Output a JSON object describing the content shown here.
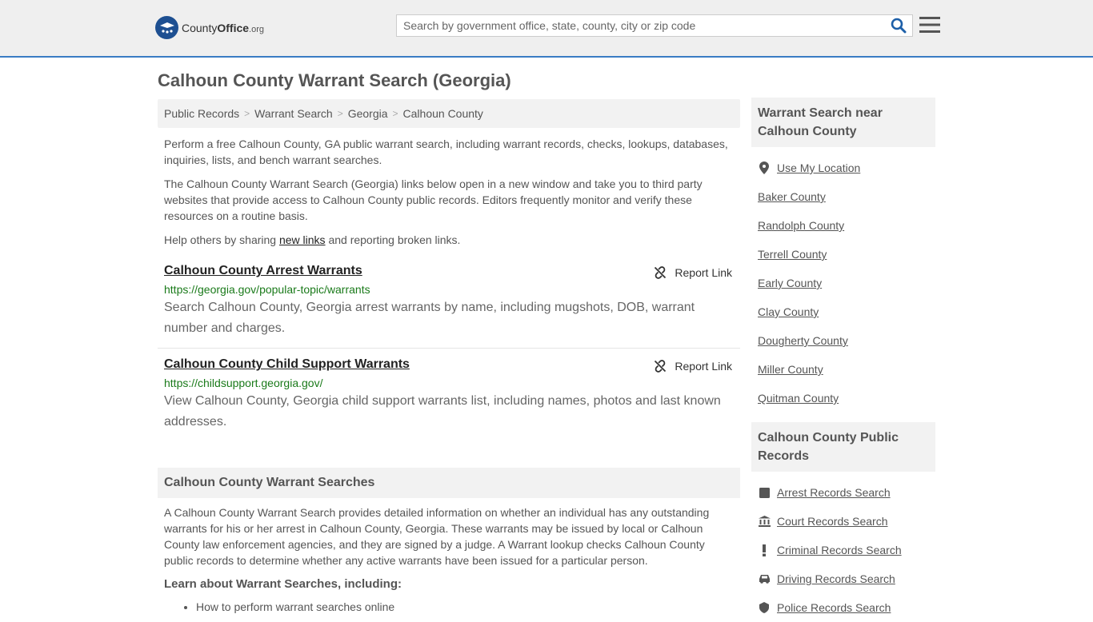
{
  "header": {
    "logo_main": "County",
    "logo_bold": "Office",
    "logo_tld": ".org",
    "search_placeholder": "Search by government office, state, county, city or zip code"
  },
  "page_title": "Calhoun County Warrant Search (Georgia)",
  "breadcrumb": [
    "Public Records",
    "Warrant Search",
    "Georgia",
    "Calhoun County"
  ],
  "intro": {
    "p1": "Perform a free Calhoun County, GA public warrant search, including warrant records, checks, lookups, databases, inquiries, lists, and bench warrant searches.",
    "p2": "The Calhoun County Warrant Search (Georgia) links below open in a new window and take you to third party websites that provide access to Calhoun County public records. Editors frequently monitor and verify these resources on a routine basis.",
    "p3_before": "Help others by sharing ",
    "p3_link": "new links",
    "p3_after": " and reporting broken links."
  },
  "report_label": "Report Link",
  "links": [
    {
      "title": "Calhoun County Arrest Warrants",
      "url": "https://georgia.gov/popular-topic/warrants",
      "desc": "Search Calhoun County, Georgia arrest warrants by name, including mugshots, DOB, warrant number and charges."
    },
    {
      "title": "Calhoun County Child Support Warrants",
      "url": "https://childsupport.georgia.gov/",
      "desc": "View Calhoun County, Georgia child support warrants list, including names, photos and last known addresses."
    }
  ],
  "searches_section": {
    "heading": "Calhoun County Warrant Searches",
    "body": "A Calhoun County Warrant Search provides detailed information on whether an individual has any outstanding warrants for his or her arrest in Calhoun County, Georgia. These warrants may be issued by local or Calhoun County law enforcement agencies, and they are signed by a judge. A Warrant lookup checks Calhoun County public records to determine whether any active warrants have been issued for a particular person.",
    "learn_heading": "Learn about Warrant Searches, including:",
    "learn_items": [
      "How to perform warrant searches online"
    ]
  },
  "sidebar": {
    "nearby_heading": "Warrant Search near Calhoun County",
    "use_location": "Use My Location",
    "nearby": [
      "Baker County",
      "Randolph County",
      "Terrell County",
      "Early County",
      "Clay County",
      "Dougherty County",
      "Miller County",
      "Quitman County"
    ],
    "records_heading": "Calhoun County Public Records",
    "records": [
      {
        "label": "Arrest Records Search",
        "icon": "square-icon"
      },
      {
        "label": "Court Records Search",
        "icon": "courthouse-icon"
      },
      {
        "label": "Criminal Records Search",
        "icon": "exclamation-icon"
      },
      {
        "label": "Driving Records Search",
        "icon": "car-icon"
      },
      {
        "label": "Police Records Search",
        "icon": "police-icon"
      }
    ]
  }
}
